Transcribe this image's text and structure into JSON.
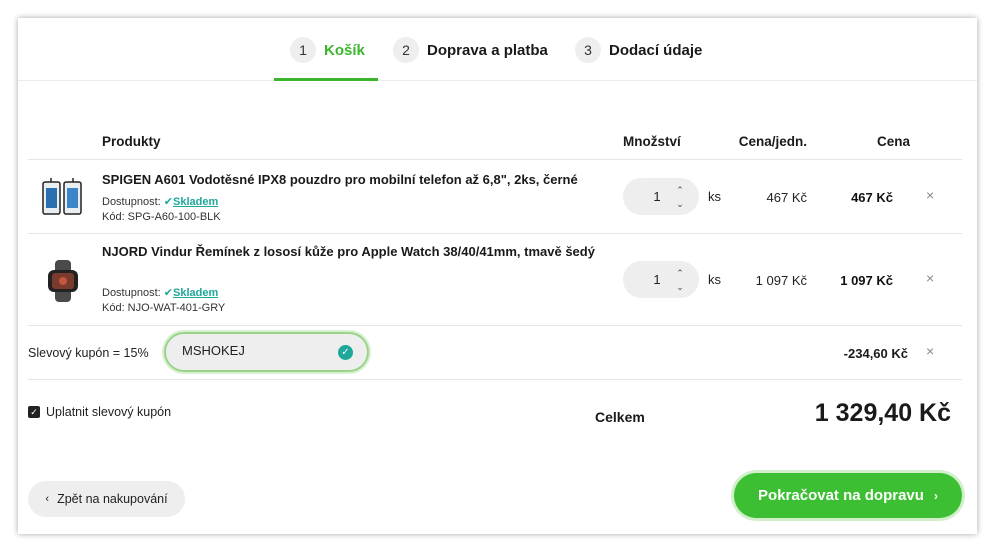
{
  "steps": [
    {
      "num": "1",
      "label": "Košík",
      "active": true
    },
    {
      "num": "2",
      "label": "Doprava a platba",
      "active": false
    },
    {
      "num": "3",
      "label": "Dodací údaje",
      "active": false
    }
  ],
  "table": {
    "headers": {
      "product": "Produkty",
      "quantity": "Množství",
      "unit_price": "Cena/jedn.",
      "price": "Cena"
    }
  },
  "items": [
    {
      "name": "SPIGEN A601 Vodotěsné IPX8 pouzdro pro mobilní telefon až 6,8\", 2ks, černé",
      "availability_label": "Dostupnost:",
      "availability_value": "Skladem",
      "code": "Kód: SPG-A60-100-BLK",
      "quantity": "1",
      "unit": "ks",
      "unit_price": "467 Kč",
      "price": "467 Kč",
      "thumb_icon": "phone-pouch-icon"
    },
    {
      "name": "NJORD Vindur Řemínek z lososí kůže pro Apple Watch 38/40/41mm, tmavě šedý",
      "availability_label": "Dostupnost:",
      "availability_value": "Skladem",
      "code": "Kód: NJO-WAT-401-GRY",
      "quantity": "1",
      "unit": "ks",
      "unit_price": "1 097 Kč",
      "price": "1 097 Kč",
      "thumb_icon": "watch-strap-icon"
    }
  ],
  "coupon": {
    "label": "Slevový kupón = 15%",
    "code": "MSHOKEJ",
    "discount": "-234,60 Kč"
  },
  "apply_coupon": {
    "label": "Uplatnit slevový kupón",
    "checked": true
  },
  "summary": {
    "total_label": "Celkem",
    "total_amount": "1 329,40 Kč"
  },
  "buttons": {
    "back": "Zpět na nakupování",
    "continue": "Pokračovat na dopravu"
  },
  "colors": {
    "accent": "#3cb52e",
    "stock": "#1ea89a",
    "button": "#3cbf32"
  }
}
